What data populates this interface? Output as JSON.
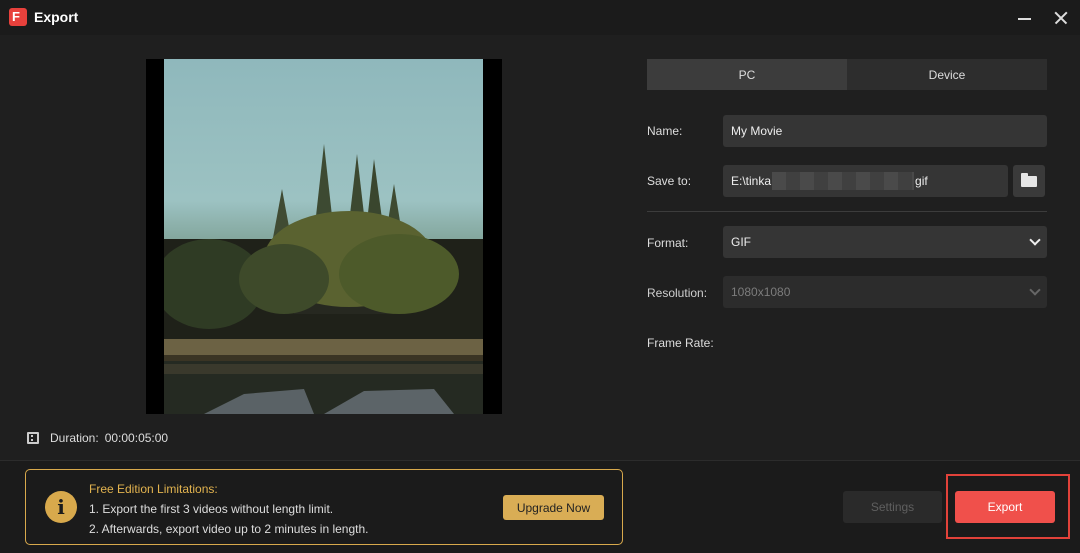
{
  "window": {
    "title": "Export",
    "logo_letter": "F"
  },
  "preview": {
    "duration_label": "Duration:",
    "duration_value": "00:00:05:00"
  },
  "tabs": [
    {
      "label": "PC",
      "active": true
    },
    {
      "label": "Device",
      "active": false
    }
  ],
  "form": {
    "name_label": "Name:",
    "name_value": "My Movie",
    "save_label": "Save to:",
    "save_prefix": "E:\\tinka",
    "save_suffix": "gif",
    "format_label": "Format:",
    "format_value": "GIF",
    "resolution_label": "Resolution:",
    "resolution_value": "1080x1080",
    "frame_rate_label": "Frame Rate:"
  },
  "limitations": {
    "title": "Free Edition Limitations:",
    "line1": "1. Export the first 3 videos without length limit.",
    "line2": "2. Afterwards, export video up to 2 minutes in length.",
    "upgrade_label": "Upgrade Now"
  },
  "footer": {
    "settings_label": "Settings",
    "export_label": "Export"
  },
  "colors": {
    "accent_export": "#f0504b",
    "accent_gold": "#d9ad55"
  }
}
